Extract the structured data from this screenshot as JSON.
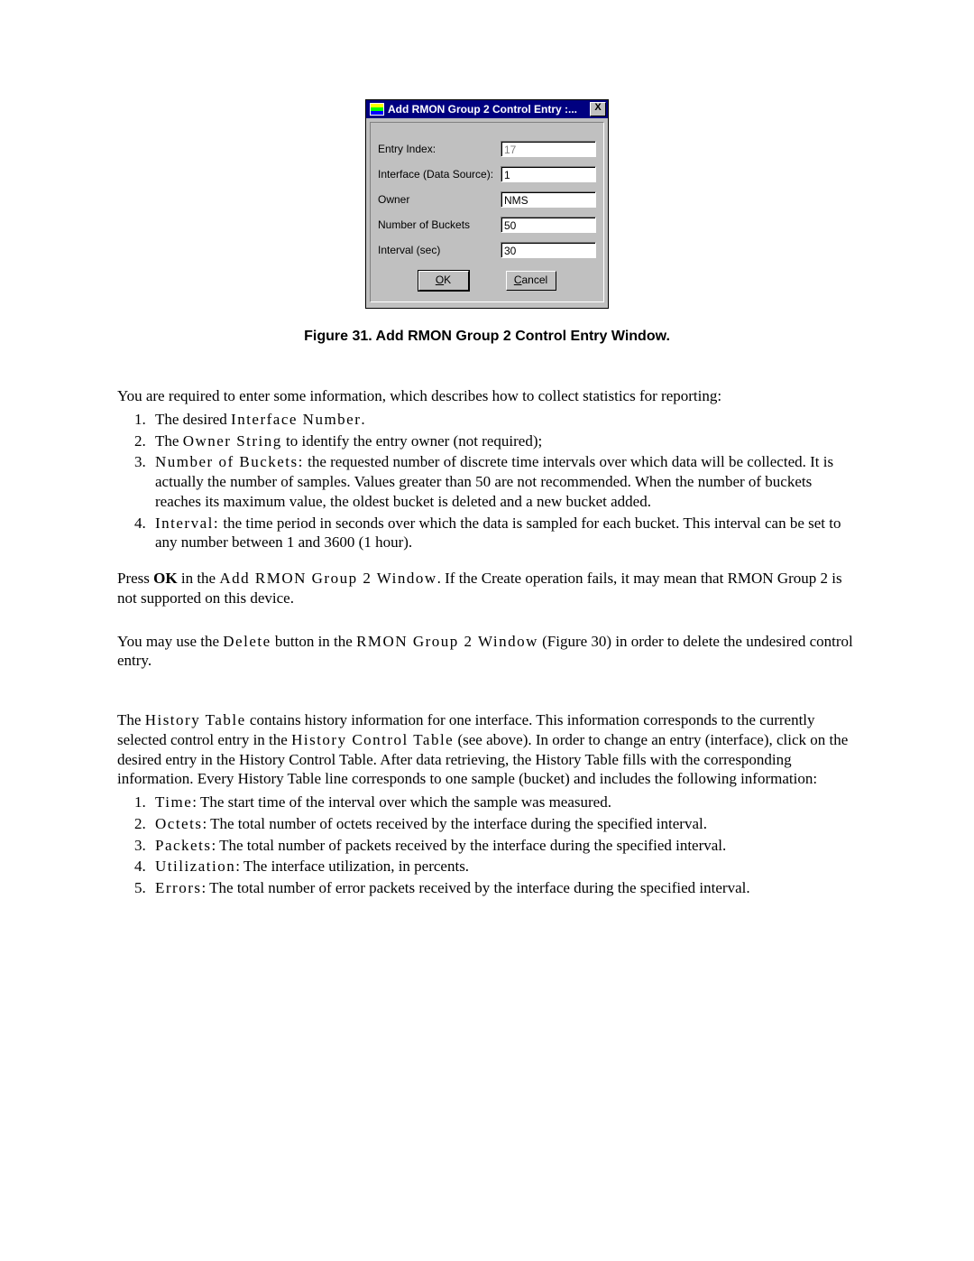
{
  "dialog": {
    "title": "Add RMON Group 2 Control Entry :...",
    "close_glyph": "X",
    "fields": {
      "entry_index": {
        "label": "Entry Index:",
        "value": "17"
      },
      "iface": {
        "label": "Interface (Data Source):",
        "value": "1"
      },
      "owner": {
        "label": "Owner",
        "value": "NMS"
      },
      "buckets": {
        "label": "Number of Buckets",
        "value": "50"
      },
      "interval": {
        "label": "Interval (sec)",
        "value": "30"
      }
    },
    "buttons": {
      "ok_u": "O",
      "ok_rest": "K",
      "cancel_u": "C",
      "cancel_rest": "ancel"
    }
  },
  "caption": "Figure 31. Add RMON Group 2 Control Entry Window.",
  "p1_lead": "You are required to enter some information, which describes how to collect statistics for reporting:",
  "list1": {
    "i1a": "The desired ",
    "i1b": "Interface Number",
    "i1c": ".",
    "i2a": "The ",
    "i2b": "Owner String",
    "i2c": " to identify the entry owner (not required);",
    "i3a": " ",
    "i3b": "Number of Buckets:",
    "i3c": "  the requested number of discrete time intervals over which data will be collected. It is actually the number of samples. Values greater than 50 are not recommended. When the number of buckets reaches its maximum value, the oldest bucket is deleted and a new bucket added.",
    "i4a": "",
    "i4b": "Interval:",
    "i4c": " the time period in seconds over which the data is sampled for each bucket. This interval can be set to any number between 1 and 3600 (1 hour)."
  },
  "p2a": "Press ",
  "p2b": "OK",
  "p2c": " in the ",
  "p2d": "Add RMON Group 2 Window",
  "p2e": ". If the Create operation fails, it may mean that RMON Group 2 is not supported on this device.",
  "p3a": "You may use the ",
  "p3b": "Delete",
  "p3c": " button in the ",
  "p3d": "RMON Group 2 Window",
  "p3e": " (Figure 30) in order to delete the undesired control entry.",
  "p4a": "The ",
  "p4b": "History Table",
  "p4c": " contains history information for one interface. This information corresponds to the currently selected control entry in the ",
  "p4d": "History Control Table",
  "p4e": " (see above).  In order to change an entry (interface), click on the desired entry in the History Control Table. After data retrieving, the History Table fills with the corresponding information. Every History Table line corresponds to one sample (bucket) and includes the following information:",
  "list2": {
    "i1a": "Time",
    "i1b": ": The start time of the interval over which the sample was measured.",
    "i2a": "Octets",
    "i2b": ": The total number of octets received by the interface during the specified interval.",
    "i3a": "Packets",
    "i3b": ": The total number of packets received by the interface during the specified interval.",
    "i4a": "Utilization",
    "i4b": ": The interface utilization, in percents.",
    "i5a": " Errors",
    "i5b": ": The total number of error packets received by the interface during the specified interval."
  }
}
